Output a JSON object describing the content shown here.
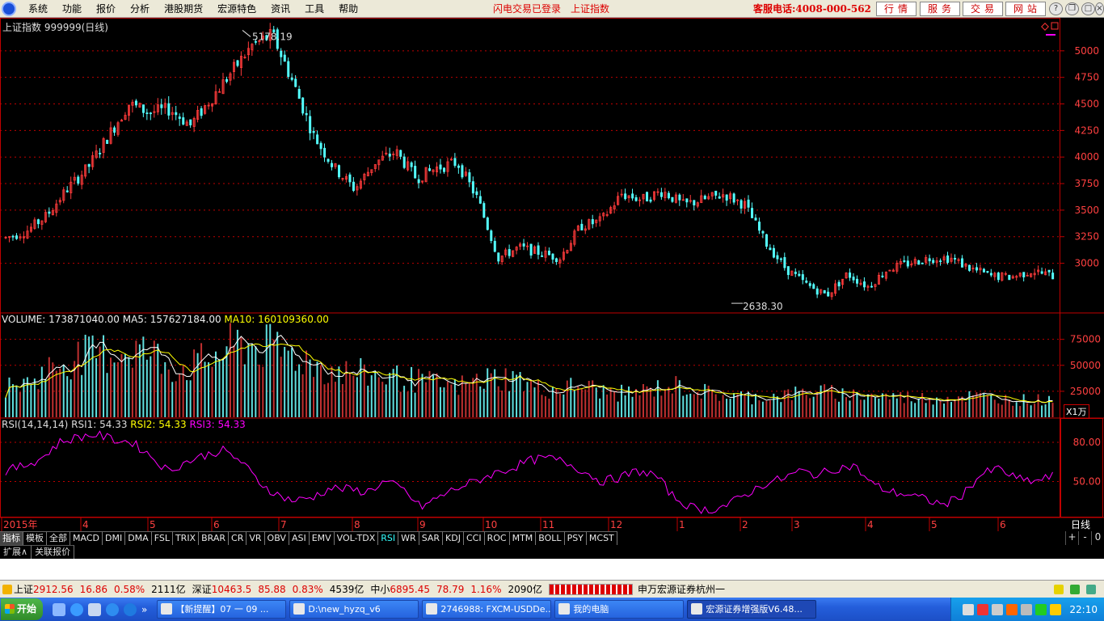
{
  "menu": {
    "items": [
      "系统",
      "功能",
      "报价",
      "分析",
      "港股期货",
      "宏源特色",
      "资讯",
      "工具",
      "帮助"
    ],
    "flash_status": "闪电交易已登录",
    "index_link": "上证指数",
    "hotline": "客服电话:4008-000-562",
    "buttons": [
      "行情",
      "服务",
      "交易",
      "网站"
    ],
    "window_controls": [
      "?",
      "❐",
      "□",
      "×"
    ]
  },
  "chart": {
    "title": "上证指数 999999(日线)",
    "high_label": "5178.19",
    "low_label": "2638.30",
    "volume_title": {
      "name": "VOLUME: 173871040.00",
      "ma5": "MA5: 157627184.00",
      "ma10": "MA10: 160109360.00"
    },
    "rsi_title": {
      "name": "RSI(14,14,14)",
      "rsi1": "RSI1: 54.33",
      "rsi2": "RSI2: 54.33",
      "rsi3": "RSI3: 54.33"
    },
    "unit_label": "X1万",
    "period_label": "日线"
  },
  "chart_data": [
    {
      "type": "candlestick",
      "title": "上证指数 999999(日线)",
      "y_ticks": [
        3000,
        3250,
        3500,
        3750,
        4000,
        4250,
        4500,
        4750,
        5000
      ],
      "ylim": [
        2540,
        5250
      ],
      "x_labels": [
        "2015年",
        "4",
        "5",
        "6",
        "7",
        "8",
        "9",
        "10",
        "11",
        "12",
        "1",
        "2",
        "3",
        "4",
        "5",
        "6"
      ],
      "annotations": [
        {
          "text": "5178.19",
          "value": 5178.19
        },
        {
          "text": "2638.30",
          "value": 2638.3
        }
      ],
      "trend_closes": [
        3240,
        3300,
        3450,
        3700,
        3900,
        4200,
        4500,
        4420,
        4450,
        4300,
        4550,
        4800,
        5050,
        5150,
        4700,
        4200,
        3900,
        3700,
        3950,
        4050,
        3800,
        3900,
        3950,
        3600,
        3050,
        3150,
        3100,
        3050,
        3350,
        3400,
        3650,
        3600,
        3680,
        3550,
        3600,
        3650,
        3550,
        3200,
        2950,
        2800,
        2700,
        2900,
        2780,
        2950,
        3000,
        3050,
        3050,
        2950,
        2880,
        2870,
        2930,
        2880
      ]
    },
    {
      "type": "bar",
      "title": "VOLUME",
      "y_ticks": [
        25000,
        50000,
        75000
      ],
      "unit": "X1万",
      "series": [
        {
          "name": "MA5",
          "value": 157627184.0
        },
        {
          "name": "MA10",
          "value": 160109360.0
        }
      ],
      "trend_values": [
        28000,
        32000,
        45000,
        55000,
        58000,
        62000,
        65000,
        58000,
        45000,
        50000,
        60000,
        70000,
        66000,
        62000,
        55000,
        45000,
        42000,
        40000,
        38000,
        35000,
        32000,
        28000,
        34000,
        38000,
        36000,
        26000,
        27000,
        30000,
        24000,
        22000,
        25000,
        30000,
        28000,
        22000,
        20000,
        19000,
        20000,
        22000,
        24000,
        22000,
        21000,
        20000,
        19000,
        18000,
        19000,
        20000,
        18000,
        17000,
        16000,
        17000
      ]
    },
    {
      "type": "line",
      "title": "RSI(14,14,14)",
      "y_ticks": [
        50,
        80
      ],
      "ylim": [
        23,
        98
      ],
      "series": [
        {
          "name": "RSI1",
          "value": 54.33
        }
      ],
      "trend_values": [
        58,
        62,
        68,
        80,
        84,
        86,
        82,
        80,
        70,
        58,
        65,
        70,
        74,
        66,
        50,
        40,
        35,
        38,
        45,
        44,
        42,
        50,
        44,
        30,
        38,
        45,
        50,
        56,
        60,
        66,
        68,
        65,
        58,
        50,
        53,
        58,
        55,
        38,
        30,
        28,
        32,
        40,
        48,
        52,
        58,
        55,
        60,
        62,
        48,
        42,
        40,
        36,
        32,
        40,
        55,
        60,
        52,
        50,
        54
      ]
    }
  ],
  "indicator_tabs": [
    "指标",
    "模板",
    "全部",
    "MACD",
    "DMI",
    "DMA",
    "FSL",
    "TRIX",
    "BRAR",
    "CR",
    "VR",
    "OBV",
    "ASI",
    "EMV",
    "VOL-TDX",
    "RSI",
    "WR",
    "SAR",
    "KDJ",
    "CCI",
    "ROC",
    "MTM",
    "BOLL",
    "PSY",
    "MCST"
  ],
  "extension_tabs": [
    "扩展∧",
    "关联报价"
  ],
  "tab_controls": [
    "+",
    "-",
    "0"
  ],
  "status": {
    "sh_label": "上证",
    "sh_value": "2912.56",
    "sh_change": "16.86",
    "sh_pct": "0.58%",
    "sh_amount": "2111亿",
    "sz_label": "深证",
    "sz_value": "10463.5",
    "sz_change": "85.88",
    "sz_pct": "0.83%",
    "sz_amount": "4539亿",
    "zx_label": "中小",
    "zx_value": "6895.45",
    "zx_change": "78.79",
    "zx_pct": "1.16%",
    "zx_amount": "2090亿",
    "broker": "申万宏源证券杭州一"
  },
  "taskbar": {
    "start": "开始",
    "tasks": [
      "【新提醒】07 一 09 ...",
      "D:\\new_hyzq_v6",
      "2746988: FXCM-USDDe...",
      "我的电脑",
      "宏源证券增强版V6.48..."
    ],
    "clock": "22:10"
  },
  "colors": {
    "up": "#ff3b3b",
    "down": "#54ffff",
    "ma5": "#ffffff",
    "ma10": "#ffff00",
    "rsi": "#ff00ff",
    "grid": "#c00000"
  }
}
